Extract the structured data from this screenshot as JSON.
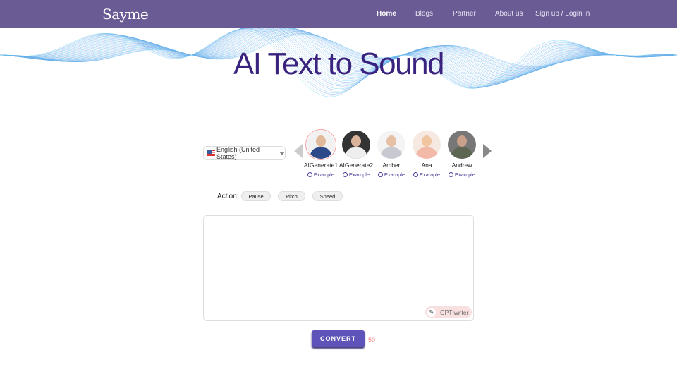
{
  "nav": {
    "logo": "Sayme",
    "items": [
      {
        "label": "Home",
        "active": true
      },
      {
        "label": "Blogs"
      },
      {
        "label": "Partner"
      },
      {
        "label": "About us"
      },
      {
        "label": "Sign up / Login in"
      }
    ]
  },
  "hero": {
    "title": "AI Text to Sound"
  },
  "language": {
    "selected": "English (United States)",
    "flag": "us-flag-icon"
  },
  "voices": [
    {
      "name": "AIGenerate1",
      "example": "Example",
      "selected": true
    },
    {
      "name": "AIGenerate2",
      "example": "Example"
    },
    {
      "name": "Amber",
      "example": "Example"
    },
    {
      "name": "Ana",
      "example": "Example"
    },
    {
      "name": "Andrew",
      "example": "Example"
    }
  ],
  "actions": {
    "label": "Action:",
    "buttons": [
      "Pause",
      "Pitch",
      "Speed"
    ]
  },
  "editor": {
    "value": "",
    "gpt_label": "GPT writer"
  },
  "convert": {
    "label": "CONVERT",
    "count": "50"
  },
  "colors": {
    "nav": "#6b5b95",
    "title": "#3a237f",
    "button": "#5d53b8",
    "count": "#f08080"
  }
}
